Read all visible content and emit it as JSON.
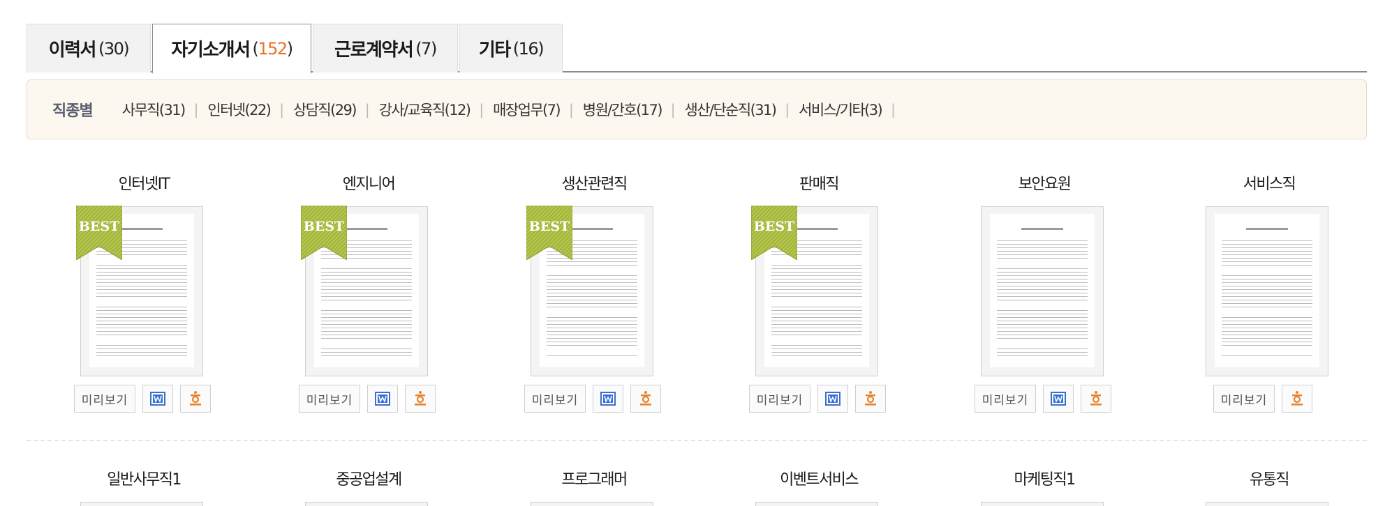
{
  "tabs": [
    {
      "name": "이력서",
      "open": "(",
      "num": "30",
      "close": ")",
      "active": false
    },
    {
      "name": "자기소개서",
      "open": "(",
      "num": "152",
      "close": ")",
      "active": true
    },
    {
      "name": "근로계약서",
      "open": "(",
      "num": "7",
      "close": ")",
      "active": false
    },
    {
      "name": "기타",
      "open": "(",
      "num": "16",
      "close": ")",
      "active": false
    }
  ],
  "filter": {
    "label": "직종별",
    "items": [
      "사무직(31)",
      "인터넷(22)",
      "상담직(29)",
      "강사/교육직(12)",
      "매장업무(7)",
      "병원/간호(17)",
      "생산/단순직(31)",
      "서비스/기타(3)"
    ],
    "separator": "|"
  },
  "preview_label": "미리보기",
  "best_label": "BEST",
  "row1": [
    {
      "title": "인터넷IT",
      "best": true,
      "word": true,
      "hwp": true
    },
    {
      "title": "엔지니어",
      "best": true,
      "word": true,
      "hwp": true
    },
    {
      "title": "생산관련직",
      "best": true,
      "word": true,
      "hwp": true
    },
    {
      "title": "판매직",
      "best": true,
      "word": true,
      "hwp": true
    },
    {
      "title": "보안요원",
      "best": false,
      "word": true,
      "hwp": true
    },
    {
      "title": "서비스직",
      "best": false,
      "word": false,
      "hwp": true
    }
  ],
  "row2": [
    {
      "title": "일반사무직1"
    },
    {
      "title": "중공업설계"
    },
    {
      "title": "프로그래머"
    },
    {
      "title": "이벤트서비스"
    },
    {
      "title": "마케팅직1"
    },
    {
      "title": "유통직"
    }
  ],
  "colors": {
    "accent_number": "#e8732a",
    "word_blue": "#3a6fd0",
    "hwp_orange": "#e8822a",
    "best_green": "#a3b43a"
  },
  "icons": {
    "word": "word-file-icon",
    "hwp": "hwp-file-icon",
    "best": "best-ribbon-icon"
  }
}
